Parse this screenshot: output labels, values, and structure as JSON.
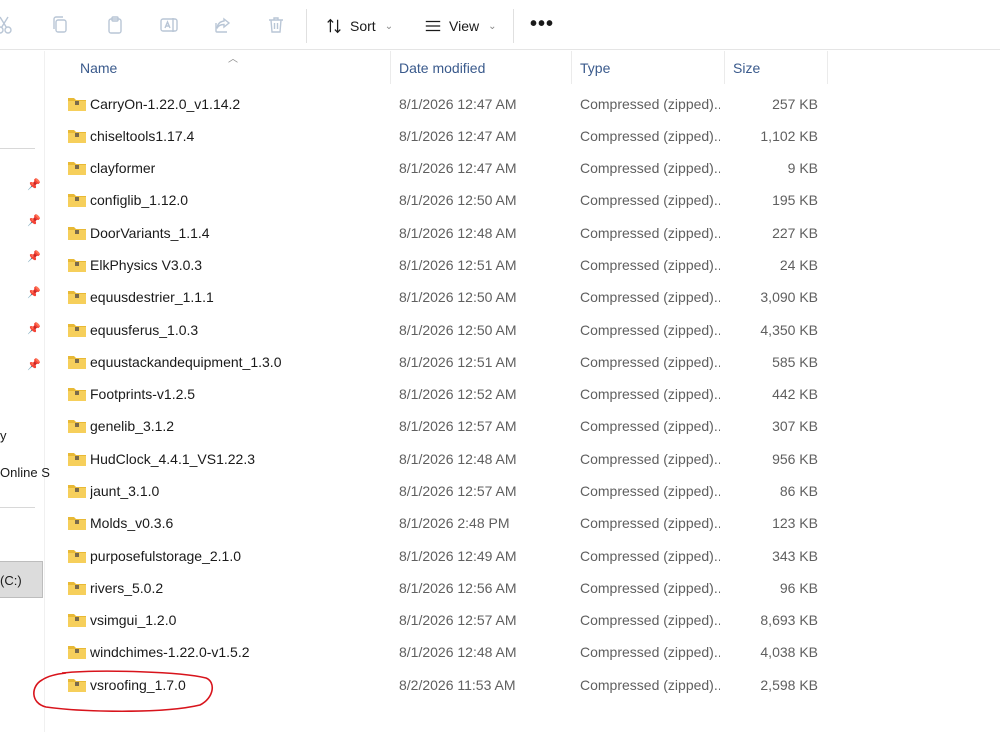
{
  "toolbar": {
    "sort_label": "Sort",
    "view_label": "View",
    "more_label": "•••",
    "icons": [
      "cut-icon",
      "copy-icon",
      "paste-icon",
      "rename-icon",
      "share-icon",
      "delete-icon"
    ]
  },
  "nav": {
    "partial_label_1": "y",
    "partial_label_2": "Online S",
    "drive_label": "(C:)"
  },
  "columns": {
    "name": "Name",
    "date": "Date modified",
    "type": "Type",
    "size": "Size"
  },
  "files": [
    {
      "name": "CarryOn-1.22.0_v1.14.2",
      "date": "8/1/2026 12:47 AM",
      "type": "Compressed (zipped)...",
      "size": "257 KB"
    },
    {
      "name": "chiseltools1.17.4",
      "date": "8/1/2026 12:47 AM",
      "type": "Compressed (zipped)...",
      "size": "1,102 KB"
    },
    {
      "name": "clayformer",
      "date": "8/1/2026 12:47 AM",
      "type": "Compressed (zipped)...",
      "size": "9 KB"
    },
    {
      "name": "configlib_1.12.0",
      "date": "8/1/2026 12:50 AM",
      "type": "Compressed (zipped)...",
      "size": "195 KB"
    },
    {
      "name": "DoorVariants_1.1.4",
      "date": "8/1/2026 12:48 AM",
      "type": "Compressed (zipped)...",
      "size": "227 KB"
    },
    {
      "name": "ElkPhysics V3.0.3",
      "date": "8/1/2026 12:51 AM",
      "type": "Compressed (zipped)...",
      "size": "24 KB"
    },
    {
      "name": "equusdestrier_1.1.1",
      "date": "8/1/2026 12:50 AM",
      "type": "Compressed (zipped)...",
      "size": "3,090 KB"
    },
    {
      "name": "equusferus_1.0.3",
      "date": "8/1/2026 12:50 AM",
      "type": "Compressed (zipped)...",
      "size": "4,350 KB"
    },
    {
      "name": "equustackandequipment_1.3.0",
      "date": "8/1/2026 12:51 AM",
      "type": "Compressed (zipped)...",
      "size": "585 KB"
    },
    {
      "name": "Footprints-v1.2.5",
      "date": "8/1/2026 12:52 AM",
      "type": "Compressed (zipped)...",
      "size": "442 KB"
    },
    {
      "name": "genelib_3.1.2",
      "date": "8/1/2026 12:57 AM",
      "type": "Compressed (zipped)...",
      "size": "307 KB"
    },
    {
      "name": "HudClock_4.4.1_VS1.22.3",
      "date": "8/1/2026 12:48 AM",
      "type": "Compressed (zipped)...",
      "size": "956 KB"
    },
    {
      "name": "jaunt_3.1.0",
      "date": "8/1/2026 12:57 AM",
      "type": "Compressed (zipped)...",
      "size": "86 KB"
    },
    {
      "name": "Molds_v0.3.6",
      "date": "8/1/2026 2:48 PM",
      "type": "Compressed (zipped)...",
      "size": "123 KB"
    },
    {
      "name": "purposefulstorage_2.1.0",
      "date": "8/1/2026 12:49 AM",
      "type": "Compressed (zipped)...",
      "size": "343 KB"
    },
    {
      "name": "rivers_5.0.2",
      "date": "8/1/2026 12:56 AM",
      "type": "Compressed (zipped)...",
      "size": "96 KB"
    },
    {
      "name": "vsimgui_1.2.0",
      "date": "8/1/2026 12:57 AM",
      "type": "Compressed (zipped)...",
      "size": "8,693 KB"
    },
    {
      "name": "windchimes-1.22.0-v1.5.2",
      "date": "8/1/2026 12:48 AM",
      "type": "Compressed (zipped)...",
      "size": "4,038 KB"
    },
    {
      "name": "vsroofing_1.7.0",
      "date": "8/2/2026 11:53 AM",
      "type": "Compressed (zipped)...",
      "size": "2,598 KB"
    }
  ],
  "colors": {
    "annotation": "#d8141c",
    "header_text": "#3a5a8c",
    "folder_yellow": "#e8b936"
  }
}
